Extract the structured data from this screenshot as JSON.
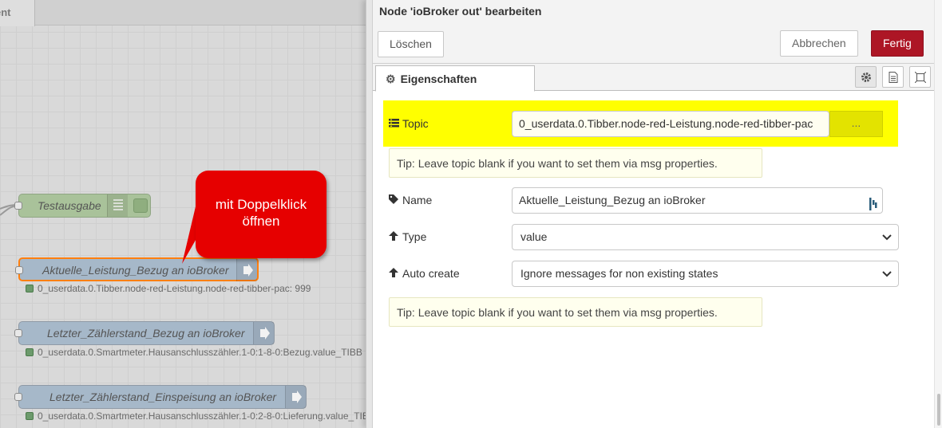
{
  "workspace": {
    "tab_label": "ent",
    "nodes": [
      {
        "label": "Testausgabe"
      },
      {
        "label": "Aktuelle_Leistung_Bezug an ioBroker",
        "status": "0_userdata.0.Tibber.node-red-Leistung.node-red-tibber-pac: 999"
      },
      {
        "label": "Letzter_Zählerstand_Bezug an ioBroker",
        "status": "0_userdata.0.Smartmeter.Hausanschlusszähler.1-0:1-8-0:Bezug.value_TIBB"
      },
      {
        "label": "Letzter_Zählerstand_Einspeisung an ioBroker",
        "status": "0_userdata.0.Smartmeter.Hausanschlusszähler.1-0:2-8-0:Lieferung.value_TIB"
      }
    ],
    "callout": {
      "line1": "mit Doppelklick",
      "line2": "öffnen",
      "color": "#e60000"
    }
  },
  "tray": {
    "title": "Node 'ioBroker out' bearbeiten",
    "delete_label": "Löschen",
    "cancel_label": "Abbrechen",
    "done_label": "Fertig",
    "done_color": "#ad1625",
    "tab_label": "Eigenschaften",
    "tab_icons": [
      "gear-icon",
      "document-icon",
      "frame-icon"
    ]
  },
  "form": {
    "topic_label": "Topic",
    "topic_value": "0_userdata.0.Tibber.node-red-Leistung.node-red-tibber-pac",
    "topic_button": "...",
    "highlight_color": "#ffff00",
    "tip1": "Tip: Leave topic blank if you want to set them via msg properties.",
    "name_label": "Name",
    "name_value": "Aktuelle_Leistung_Bezug an ioBroker",
    "type_label": "Type",
    "type_value": "value",
    "autocreate_label": "Auto create",
    "autocreate_value": "Ignore messages for non existing states",
    "tip2": "Tip: Leave topic blank if you want to set them via msg properties."
  }
}
